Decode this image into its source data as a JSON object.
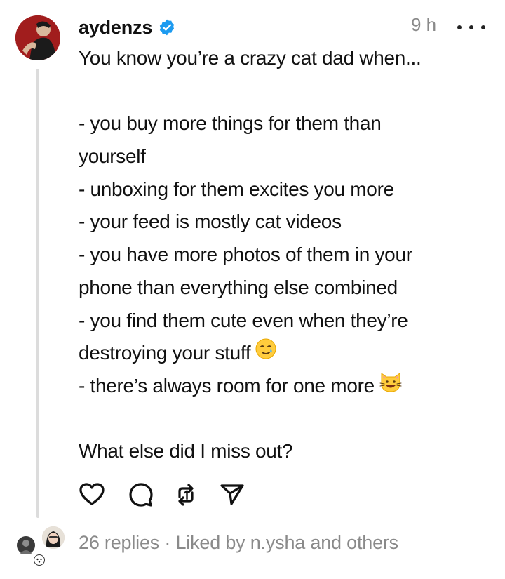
{
  "post": {
    "username": "aydenzs",
    "time": "9 h",
    "lines": [
      "You know you’re a crazy cat dad when...",
      "",
      "- you buy more things for them than",
      "yourself",
      "- unboxing for them excites you more",
      "- your feed is mostly cat videos",
      "- you have more photos of them in your",
      "phone than everything else combined",
      "- you find them cute even when they’re",
      "destroying your stuff",
      "- there’s always room for one more",
      "",
      "What else did I miss out?"
    ],
    "replies_text": "26 replies · Liked by n.ysha and others"
  },
  "icons": {
    "verified": "verified-badge-icon",
    "more": "more-horizontal-icon",
    "like": "heart-icon",
    "comment": "comment-bubble-icon",
    "repost": "repost-icon",
    "share": "send-icon",
    "emoji_tear": "smiling-face-with-tear-icon",
    "emoji_cat": "grinning-cat-icon"
  },
  "colors": {
    "verified": "#1d9bf0",
    "muted": "#8a8a8a",
    "text": "#111111",
    "thread_line": "#dcdcdc"
  }
}
